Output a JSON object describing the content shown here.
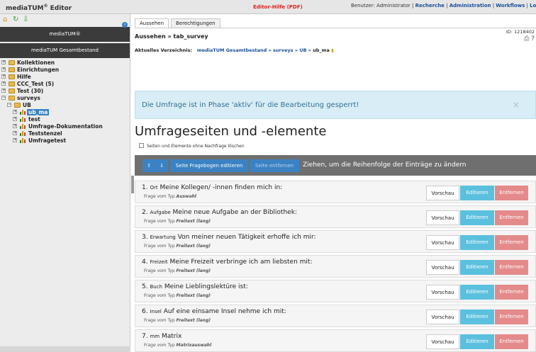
{
  "app": {
    "title": "mediaTUM",
    "title_sup": "®",
    "title_suffix": " Editor"
  },
  "header": {
    "help_link": "Editor-Hilfe (PDF)",
    "user_prefix": "Benutzer: Administrator | ",
    "links": [
      "Recherche",
      "Administration",
      "Workflows",
      "Logo"
    ]
  },
  "sidebar": {
    "block1": "mediaTUM®",
    "block2": "mediaTUM Gesamtbestand",
    "tree": [
      {
        "label": "Kollektionen",
        "toggle": "+"
      },
      {
        "label": "Einrichtungen",
        "toggle": "+"
      },
      {
        "label": "Hilfe",
        "toggle": "+"
      },
      {
        "label": "CCC_Test (5)",
        "toggle": "+"
      },
      {
        "label": "Test (30)",
        "toggle": "+"
      },
      {
        "label": "surveys",
        "toggle": "−"
      },
      {
        "label": "UB",
        "toggle": "−"
      },
      {
        "label": "ub_ma",
        "toggle": "+"
      },
      {
        "label": "test",
        "toggle": "+"
      },
      {
        "label": "Umfrage-Dokumentation",
        "toggle": "+"
      },
      {
        "label": "Teststenzel",
        "toggle": "+"
      },
      {
        "label": "Umfragetest",
        "toggle": "+"
      }
    ]
  },
  "tabs": [
    "Aussehen",
    "Berechtigungen"
  ],
  "breadcrumb": "Aussehen » tab_survey",
  "id_label": "ID: 1218402",
  "dir": {
    "label": "Aktuelles Verzeichnis:",
    "path": "mediaTUM Gesamtbestand » surveys » UB » ",
    "current": "ub_ma"
  },
  "alert": "Die Umfrage ist in Phase 'aktiv' für die Bearbeitung gesperrt!",
  "page_title": "Umfrageseiten und -elemente",
  "checkbox_label": "Seiten und Elemente ohne Nachfrage löschen",
  "toolbar": {
    "up": "⇧",
    "down": "⇩",
    "edit_questionnaire": "Seite Fragebogen editieren",
    "remove_page": "Seite entfernen",
    "hint": "Ziehen, um die Reihenfolge der Einträge zu ändern"
  },
  "buttons": {
    "preview": "Vorschau",
    "edit": "Editieren",
    "remove": "Entfernen"
  },
  "type_prefix": "Frage vom Typ ",
  "questions": [
    {
      "num": "1.",
      "code": "Ort",
      "title": "Meine Kollegen/ -innen finden mich in:",
      "type": "Auswahl"
    },
    {
      "num": "2.",
      "code": "Aufgabe",
      "title": "Meine neue Aufgabe an der Bibliothek:",
      "type": "Freitext (lang)"
    },
    {
      "num": "3.",
      "code": "Erwartung",
      "title": "Von meiner neuen Tätigkeit erhoffe ich mir:",
      "type": "Freitext (lang)"
    },
    {
      "num": "4.",
      "code": "Freizeit",
      "title": "Meine Freizeit verbringe ich am liebsten mit:",
      "type": "Freitext (lang)"
    },
    {
      "num": "5.",
      "code": "Buch",
      "title": "Meine Lieblingslektüre ist:",
      "type": "Freitext (lang)"
    },
    {
      "num": "6.",
      "code": "Insel",
      "title": "Auf eine einsame Insel nehme ich mit:",
      "type": "Freitext (lang)"
    },
    {
      "num": "7.",
      "code": "mm",
      "title": "Matrix",
      "type": "Matrixauswahl"
    }
  ]
}
